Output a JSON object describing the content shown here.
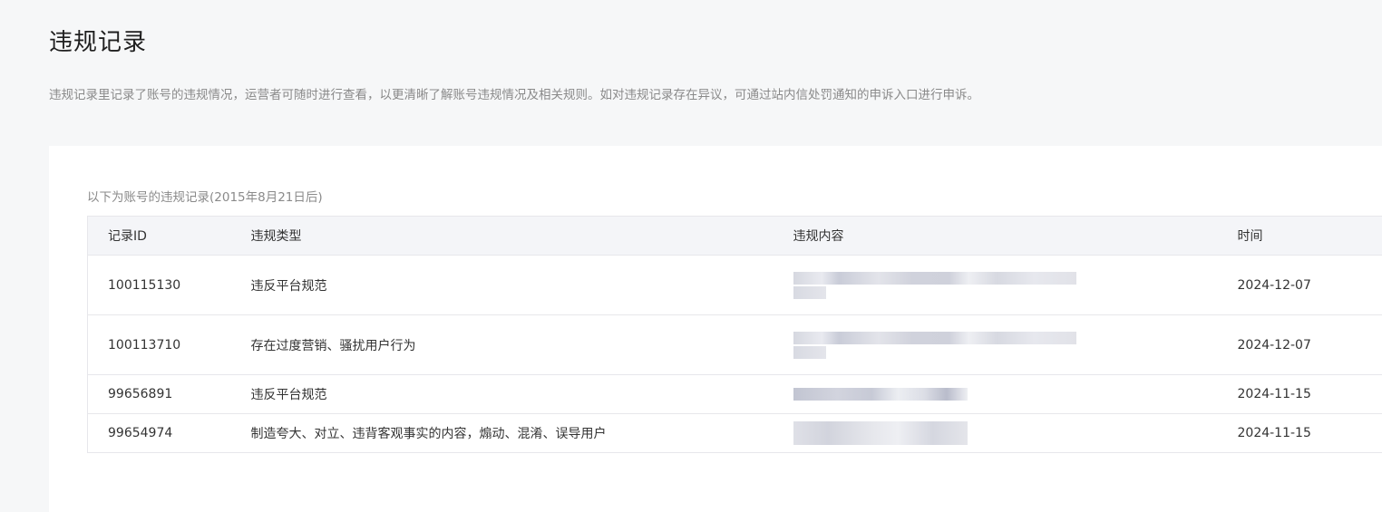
{
  "page": {
    "title": "违规记录",
    "description": "违规记录里记录了账号的违规情况，运营者可随时进行查看，以更清晰了解账号违规情况及相关规则。如对违规记录存在异议，可通过站内信处罚通知的申诉入口进行申诉。"
  },
  "table": {
    "caption": "以下为账号的违规记录(2015年8月21日后)",
    "columns": {
      "id": "记录ID",
      "type": "违规类型",
      "content": "违规内容",
      "time": "时间"
    },
    "rows": [
      {
        "id": "100115130",
        "type": "违反平台规范",
        "time": "2024-12-07"
      },
      {
        "id": "100113710",
        "type": "存在过度营销、骚扰用户行为",
        "time": "2024-12-07"
      },
      {
        "id": "99656891",
        "type": "违反平台规范",
        "time": "2024-11-15"
      },
      {
        "id": "99654974",
        "type": "制造夸大、对立、违背客观事实的内容，煽动、混淆、误导用户",
        "time": "2024-11-15"
      }
    ]
  }
}
